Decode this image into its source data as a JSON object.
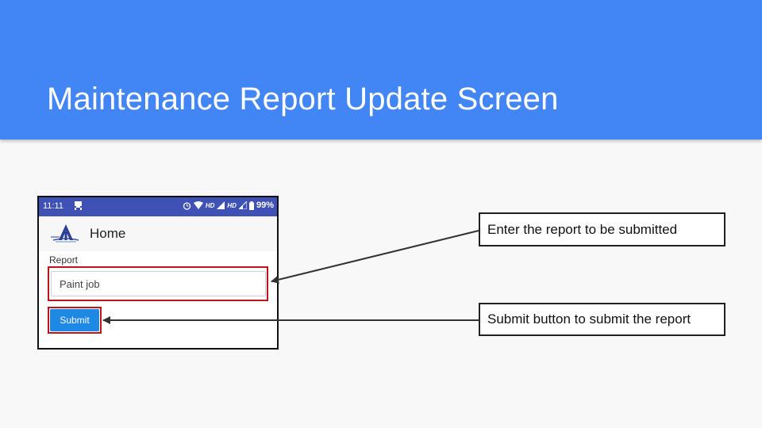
{
  "slide": {
    "title": "Maintenance Report Update Screen",
    "header_color": "#4285f4"
  },
  "phone": {
    "status_bar": {
      "time": "11:11",
      "network_label": "HD",
      "network_label_2": "HD",
      "battery": "99%",
      "color": "#3f51b5",
      "icons": [
        "notification-icon",
        "alarm-icon",
        "wifi-icon",
        "signal-icon",
        "signal-weak-icon",
        "battery-icon"
      ]
    },
    "app_bar": {
      "title": "Home",
      "logo_icon": "airport-authority-logo"
    },
    "form": {
      "report_label": "Report",
      "report_value": "Paint job",
      "submit_label": "Submit",
      "submit_color": "#1e88e5",
      "highlight_color": "#c0141a"
    }
  },
  "callouts": [
    {
      "text": "Enter the report to be submitted"
    },
    {
      "text": "Submit button to submit the report"
    }
  ]
}
